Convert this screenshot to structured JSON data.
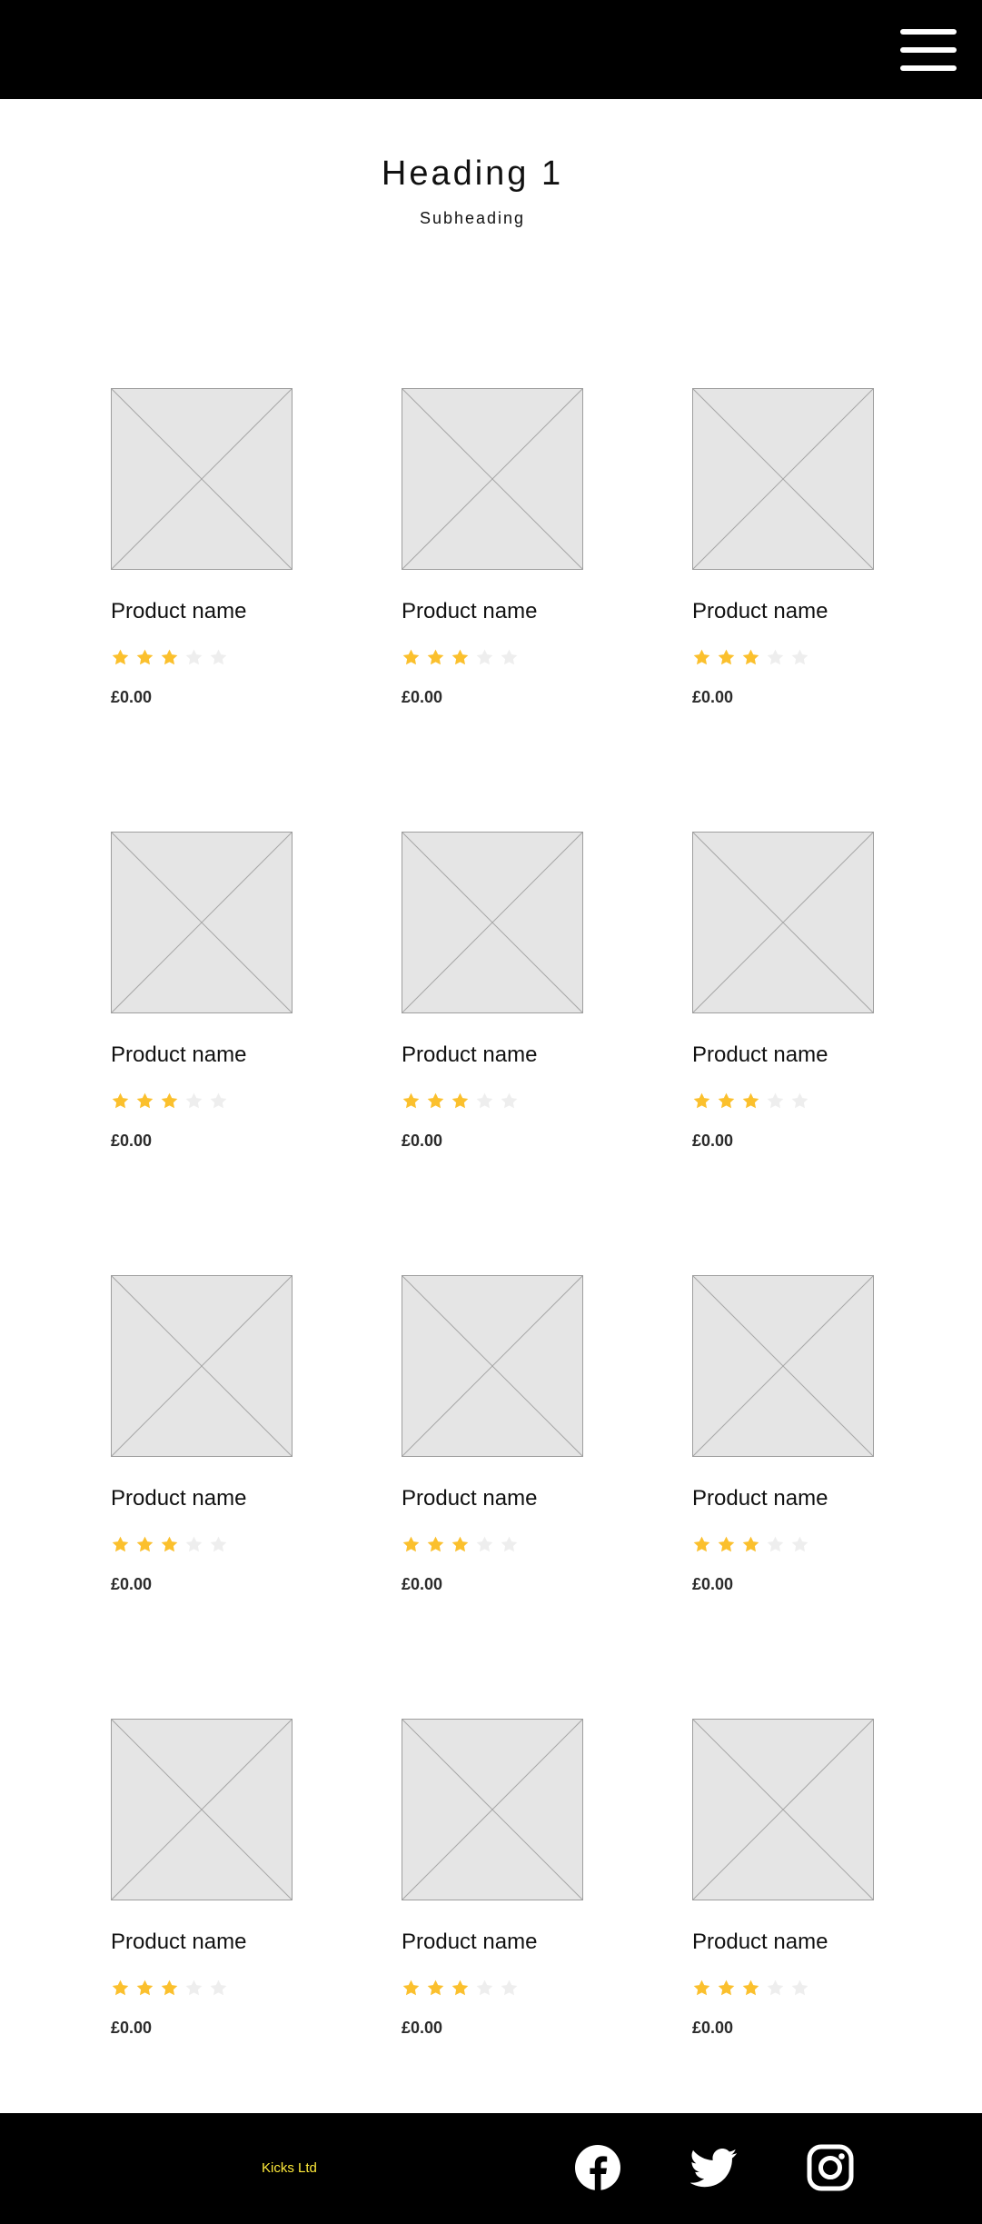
{
  "header": {
    "menu_icon": "hamburger-menu-icon"
  },
  "hero": {
    "heading": "Heading 1",
    "subheading": "Subheading"
  },
  "colors": {
    "header_bg": "#000000",
    "star_filled": "#FBC02D",
    "star_empty": "#EEEEEE",
    "brand_text": "#FFEA3A",
    "placeholder_bg": "#E5E5E5"
  },
  "products": [
    {
      "name": "Product name",
      "rating": 3,
      "max_rating": 5,
      "price": "£0.00"
    },
    {
      "name": "Product name",
      "rating": 3,
      "max_rating": 5,
      "price": "£0.00"
    },
    {
      "name": "Product name",
      "rating": 3,
      "max_rating": 5,
      "price": "£0.00"
    },
    {
      "name": "Product name",
      "rating": 3,
      "max_rating": 5,
      "price": "£0.00"
    },
    {
      "name": "Product name",
      "rating": 3,
      "max_rating": 5,
      "price": "£0.00"
    },
    {
      "name": "Product name",
      "rating": 3,
      "max_rating": 5,
      "price": "£0.00"
    },
    {
      "name": "Product name",
      "rating": 3,
      "max_rating": 5,
      "price": "£0.00"
    },
    {
      "name": "Product name",
      "rating": 3,
      "max_rating": 5,
      "price": "£0.00"
    },
    {
      "name": "Product name",
      "rating": 3,
      "max_rating": 5,
      "price": "£0.00"
    },
    {
      "name": "Product name",
      "rating": 3,
      "max_rating": 5,
      "price": "£0.00"
    },
    {
      "name": "Product name",
      "rating": 3,
      "max_rating": 5,
      "price": "£0.00"
    },
    {
      "name": "Product name",
      "rating": 3,
      "max_rating": 5,
      "price": "£0.00"
    }
  ],
  "footer": {
    "brand": "Kicks Ltd",
    "social": [
      "facebook-icon",
      "twitter-icon",
      "instagram-icon"
    ]
  }
}
